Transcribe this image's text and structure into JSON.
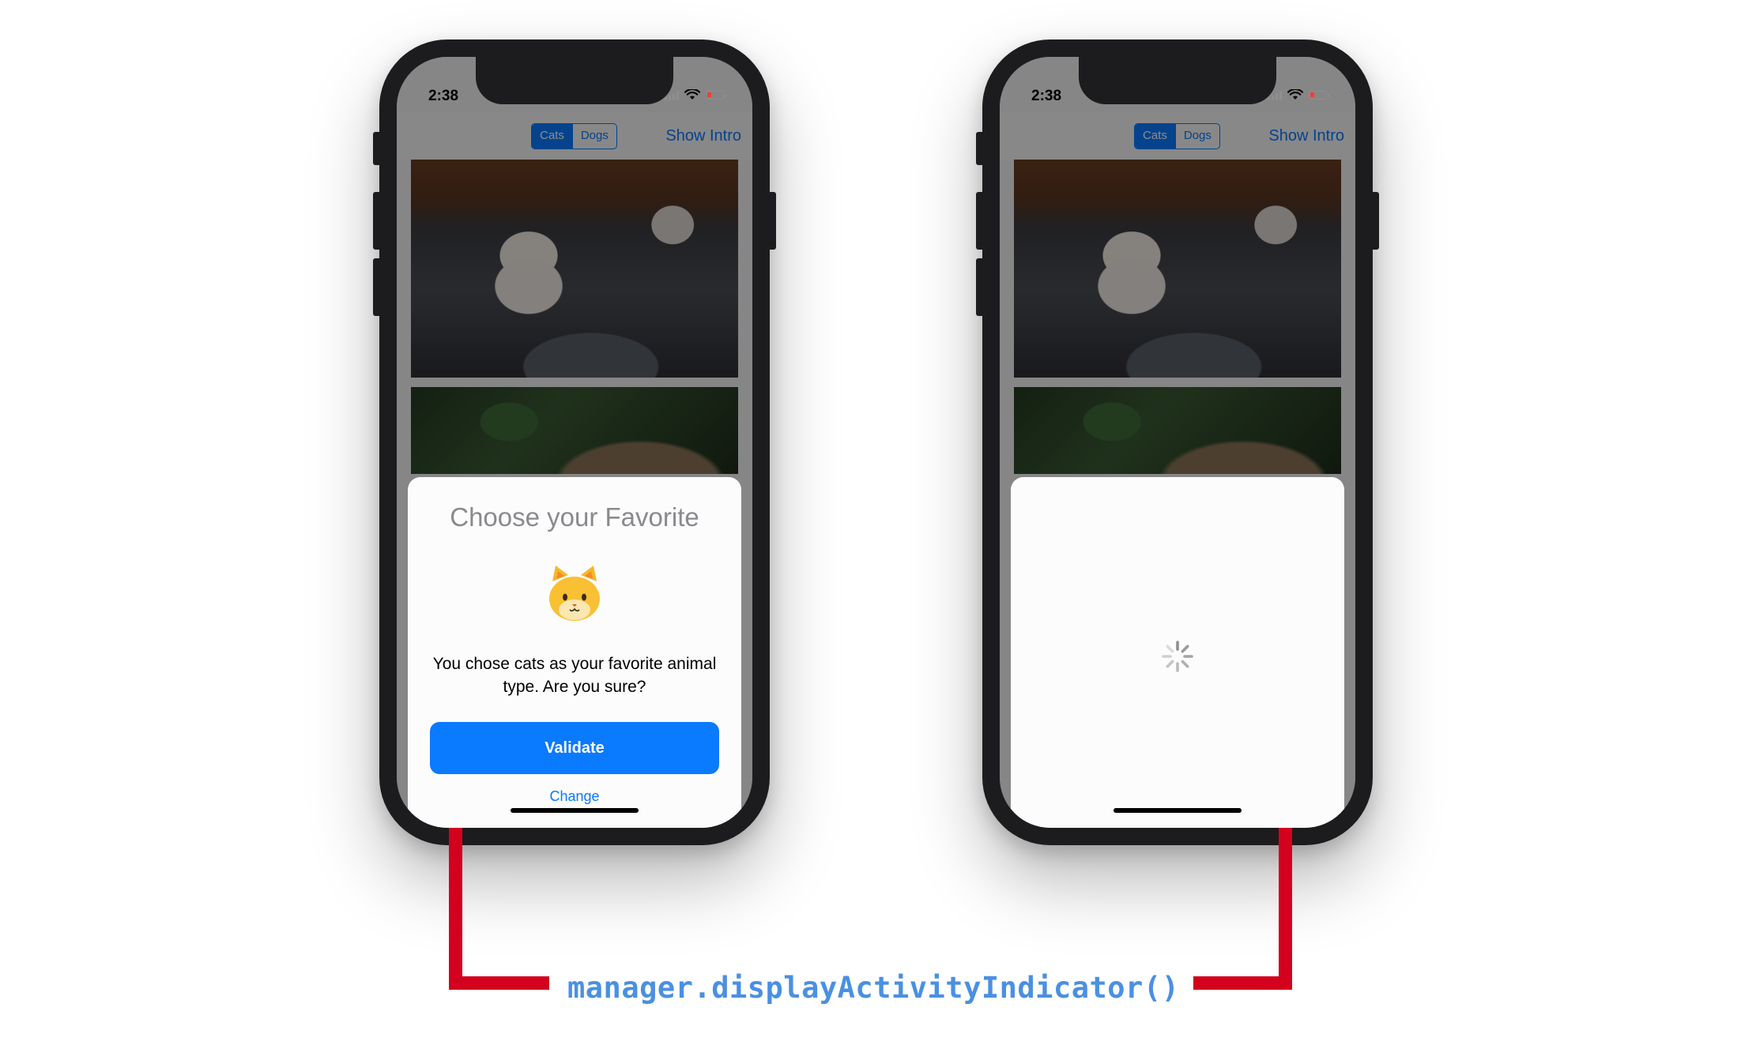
{
  "left_phone": {
    "status": {
      "time": "2:38"
    },
    "nav": {
      "segments": [
        "Cats",
        "Dogs"
      ],
      "selected_segment": "Cats",
      "right_button": "Show Intro"
    },
    "modal": {
      "title": "Choose your Favorite",
      "emoji": "cat-face",
      "message": "You chose cats as your favorite animal type. Are you sure?",
      "primary_button": "Validate",
      "secondary_button": "Change"
    }
  },
  "right_phone": {
    "status": {
      "time": "2:38"
    },
    "nav": {
      "segments": [
        "Cats",
        "Dogs"
      ],
      "selected_segment": "Cats",
      "right_button": "Show Intro"
    },
    "modal": {
      "state": "loading",
      "indicator": "activity-spinner-icon"
    }
  },
  "annotation": {
    "code": "manager.displayActivityIndicator()",
    "code_color": "#4a90e2",
    "bracket_color": "#d3001e"
  },
  "colors": {
    "tint": "#0a7aff",
    "frame": "#1c1c1e",
    "battery": "#ff3b30"
  }
}
